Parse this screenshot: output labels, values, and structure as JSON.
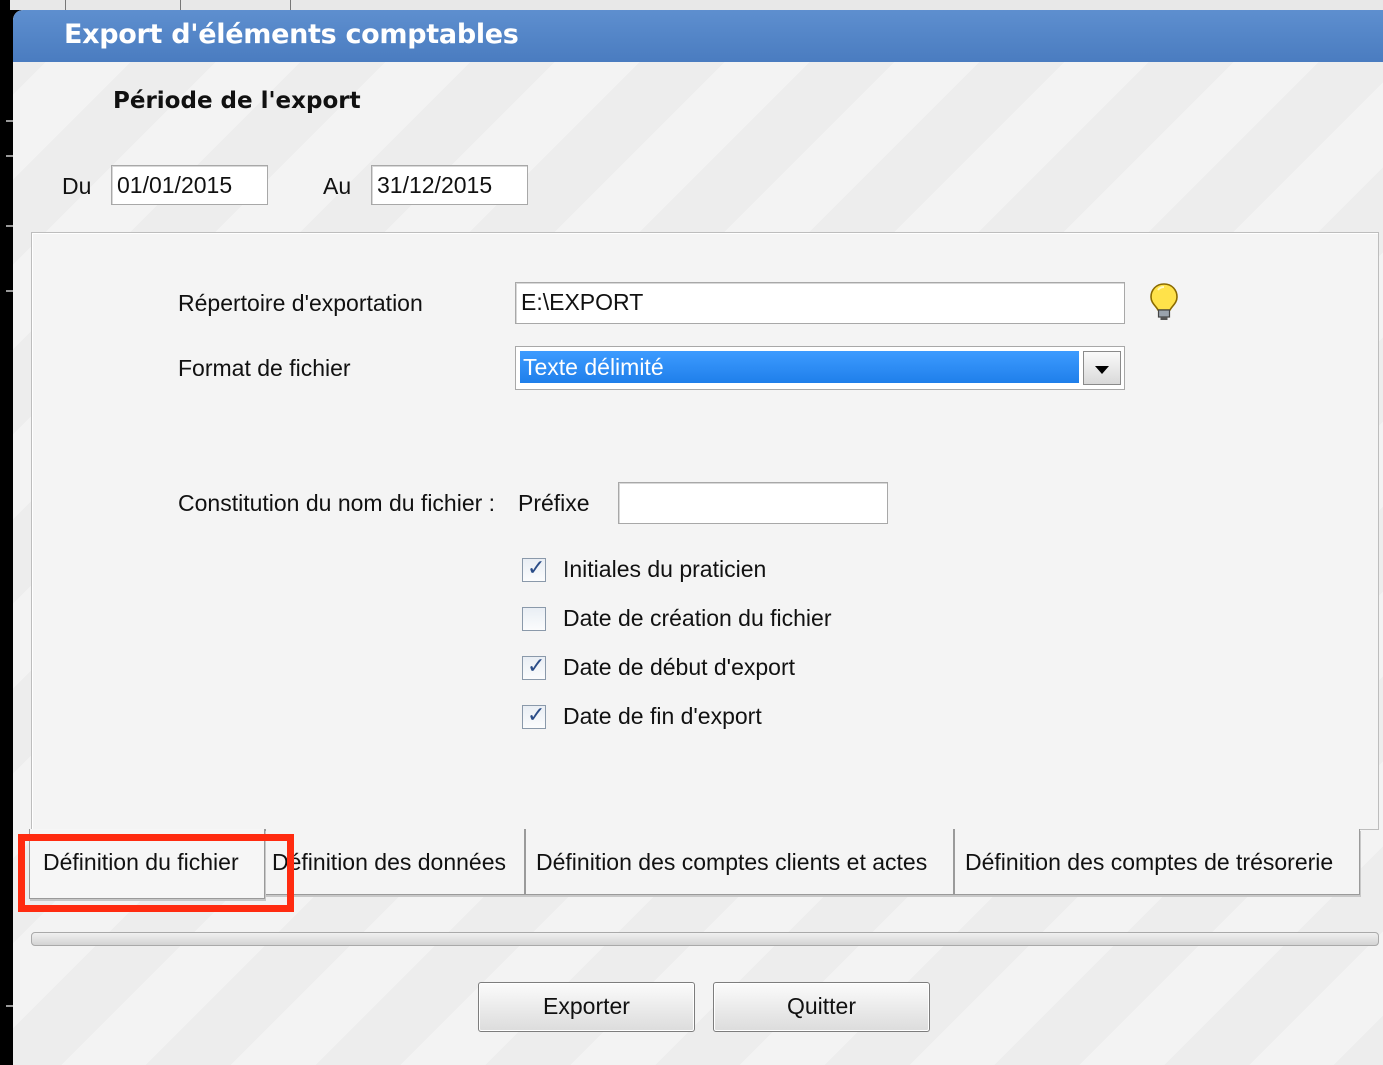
{
  "dialog": {
    "title": "Export d'éléments comptables"
  },
  "period": {
    "heading": "Période de l'export",
    "from_label": "Du",
    "from_value": "01/01/2015",
    "to_label": "Au",
    "to_value": "31/12/2015"
  },
  "file_definition": {
    "directory_label": "Répertoire d'exportation",
    "directory_value": "E:\\EXPORT",
    "format_label": "Format de fichier",
    "format_value": "Texte délimité",
    "filename_label": "Constitution du nom du fichier :",
    "prefix_label": "Préfixe",
    "prefix_value": "",
    "options": [
      {
        "label": "Initiales du praticien",
        "checked": true
      },
      {
        "label": "Date de création du fichier",
        "checked": false
      },
      {
        "label": "Date de début d'export",
        "checked": true
      },
      {
        "label": "Date de fin d'export",
        "checked": true
      }
    ]
  },
  "tabs": [
    {
      "label": "Définition du fichier",
      "active": true
    },
    {
      "label": "Définition des données",
      "active": false
    },
    {
      "label": "Définition des comptes clients et actes",
      "active": false
    },
    {
      "label": "Définition des comptes de trésorerie",
      "active": false
    }
  ],
  "buttons": {
    "export_label": "Exporter",
    "quit_label": "Quitter"
  },
  "icons": {
    "tip": "lightbulb-icon",
    "dropdown": "chevron-down-icon"
  },
  "colors": {
    "titlebar": "#4a7cc0",
    "selection": "#1f7fea",
    "highlight_box": "#ff2b10"
  }
}
